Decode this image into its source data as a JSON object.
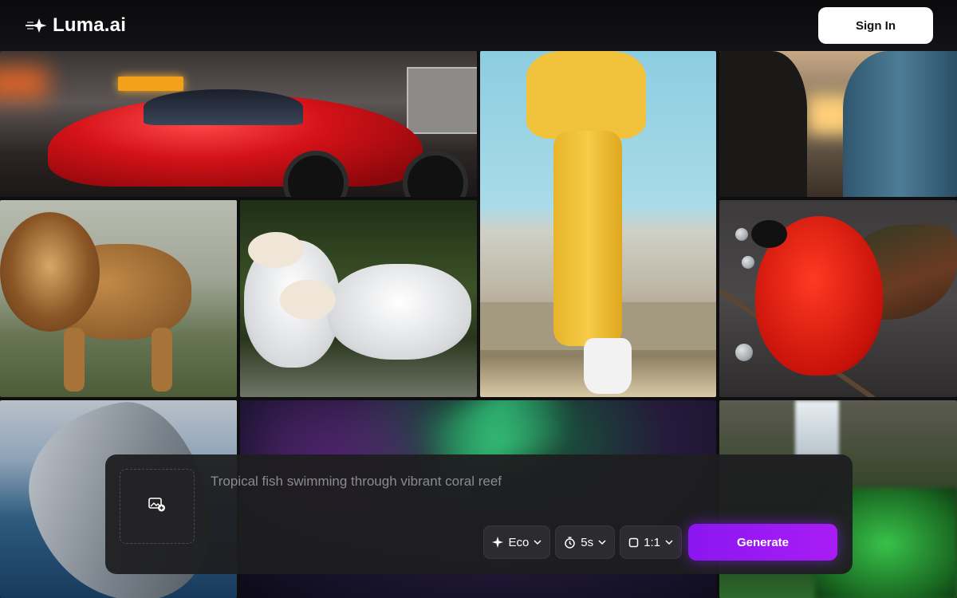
{
  "brand": {
    "name": "Luma.ai"
  },
  "header": {
    "sign_in_label": "Sign In"
  },
  "gallery": {
    "tiles": [
      "sports-car",
      "yellow-outfit",
      "couple-sunset",
      "lion",
      "white-horses",
      "cardinal",
      "dolphin",
      "aurora",
      "waterfall"
    ]
  },
  "prompt": {
    "placeholder": "Tropical fish swimming through vibrant coral reef",
    "value": "",
    "upload_icon": "image-add-icon"
  },
  "controls": {
    "mode_label": "Eco",
    "mode_icon": "sparkle-icon",
    "duration_label": "5s",
    "duration_icon": "timer-icon",
    "aspect_label": "1:1",
    "aspect_icon": "square-icon",
    "generate_label": "Generate"
  },
  "colors": {
    "accent": "#9a18f4",
    "panel": "#1e1e20",
    "signin_bg": "#ffffff"
  }
}
